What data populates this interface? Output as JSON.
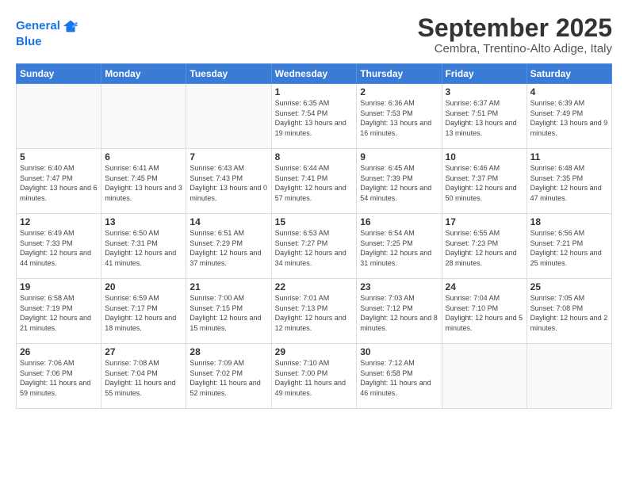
{
  "logo": {
    "line1": "General",
    "line2": "Blue"
  },
  "title": "September 2025",
  "location": "Cembra, Trentino-Alto Adige, Italy",
  "weekdays": [
    "Sunday",
    "Monday",
    "Tuesday",
    "Wednesday",
    "Thursday",
    "Friday",
    "Saturday"
  ],
  "days": [
    null,
    null,
    null,
    {
      "num": "1",
      "sunrise": "Sunrise: 6:35 AM",
      "sunset": "Sunset: 7:54 PM",
      "daylight": "Daylight: 13 hours and 19 minutes."
    },
    {
      "num": "2",
      "sunrise": "Sunrise: 6:36 AM",
      "sunset": "Sunset: 7:53 PM",
      "daylight": "Daylight: 13 hours and 16 minutes."
    },
    {
      "num": "3",
      "sunrise": "Sunrise: 6:37 AM",
      "sunset": "Sunset: 7:51 PM",
      "daylight": "Daylight: 13 hours and 13 minutes."
    },
    {
      "num": "4",
      "sunrise": "Sunrise: 6:39 AM",
      "sunset": "Sunset: 7:49 PM",
      "daylight": "Daylight: 13 hours and 9 minutes."
    },
    {
      "num": "5",
      "sunrise": "Sunrise: 6:40 AM",
      "sunset": "Sunset: 7:47 PM",
      "daylight": "Daylight: 13 hours and 6 minutes."
    },
    {
      "num": "6",
      "sunrise": "Sunrise: 6:41 AM",
      "sunset": "Sunset: 7:45 PM",
      "daylight": "Daylight: 13 hours and 3 minutes."
    },
    {
      "num": "7",
      "sunrise": "Sunrise: 6:43 AM",
      "sunset": "Sunset: 7:43 PM",
      "daylight": "Daylight: 13 hours and 0 minutes."
    },
    {
      "num": "8",
      "sunrise": "Sunrise: 6:44 AM",
      "sunset": "Sunset: 7:41 PM",
      "daylight": "Daylight: 12 hours and 57 minutes."
    },
    {
      "num": "9",
      "sunrise": "Sunrise: 6:45 AM",
      "sunset": "Sunset: 7:39 PM",
      "daylight": "Daylight: 12 hours and 54 minutes."
    },
    {
      "num": "10",
      "sunrise": "Sunrise: 6:46 AM",
      "sunset": "Sunset: 7:37 PM",
      "daylight": "Daylight: 12 hours and 50 minutes."
    },
    {
      "num": "11",
      "sunrise": "Sunrise: 6:48 AM",
      "sunset": "Sunset: 7:35 PM",
      "daylight": "Daylight: 12 hours and 47 minutes."
    },
    {
      "num": "12",
      "sunrise": "Sunrise: 6:49 AM",
      "sunset": "Sunset: 7:33 PM",
      "daylight": "Daylight: 12 hours and 44 minutes."
    },
    {
      "num": "13",
      "sunrise": "Sunrise: 6:50 AM",
      "sunset": "Sunset: 7:31 PM",
      "daylight": "Daylight: 12 hours and 41 minutes."
    },
    {
      "num": "14",
      "sunrise": "Sunrise: 6:51 AM",
      "sunset": "Sunset: 7:29 PM",
      "daylight": "Daylight: 12 hours and 37 minutes."
    },
    {
      "num": "15",
      "sunrise": "Sunrise: 6:53 AM",
      "sunset": "Sunset: 7:27 PM",
      "daylight": "Daylight: 12 hours and 34 minutes."
    },
    {
      "num": "16",
      "sunrise": "Sunrise: 6:54 AM",
      "sunset": "Sunset: 7:25 PM",
      "daylight": "Daylight: 12 hours and 31 minutes."
    },
    {
      "num": "17",
      "sunrise": "Sunrise: 6:55 AM",
      "sunset": "Sunset: 7:23 PM",
      "daylight": "Daylight: 12 hours and 28 minutes."
    },
    {
      "num": "18",
      "sunrise": "Sunrise: 6:56 AM",
      "sunset": "Sunset: 7:21 PM",
      "daylight": "Daylight: 12 hours and 25 minutes."
    },
    {
      "num": "19",
      "sunrise": "Sunrise: 6:58 AM",
      "sunset": "Sunset: 7:19 PM",
      "daylight": "Daylight: 12 hours and 21 minutes."
    },
    {
      "num": "20",
      "sunrise": "Sunrise: 6:59 AM",
      "sunset": "Sunset: 7:17 PM",
      "daylight": "Daylight: 12 hours and 18 minutes."
    },
    {
      "num": "21",
      "sunrise": "Sunrise: 7:00 AM",
      "sunset": "Sunset: 7:15 PM",
      "daylight": "Daylight: 12 hours and 15 minutes."
    },
    {
      "num": "22",
      "sunrise": "Sunrise: 7:01 AM",
      "sunset": "Sunset: 7:13 PM",
      "daylight": "Daylight: 12 hours and 12 minutes."
    },
    {
      "num": "23",
      "sunrise": "Sunrise: 7:03 AM",
      "sunset": "Sunset: 7:12 PM",
      "daylight": "Daylight: 12 hours and 8 minutes."
    },
    {
      "num": "24",
      "sunrise": "Sunrise: 7:04 AM",
      "sunset": "Sunset: 7:10 PM",
      "daylight": "Daylight: 12 hours and 5 minutes."
    },
    {
      "num": "25",
      "sunrise": "Sunrise: 7:05 AM",
      "sunset": "Sunset: 7:08 PM",
      "daylight": "Daylight: 12 hours and 2 minutes."
    },
    {
      "num": "26",
      "sunrise": "Sunrise: 7:06 AM",
      "sunset": "Sunset: 7:06 PM",
      "daylight": "Daylight: 11 hours and 59 minutes."
    },
    {
      "num": "27",
      "sunrise": "Sunrise: 7:08 AM",
      "sunset": "Sunset: 7:04 PM",
      "daylight": "Daylight: 11 hours and 55 minutes."
    },
    {
      "num": "28",
      "sunrise": "Sunrise: 7:09 AM",
      "sunset": "Sunset: 7:02 PM",
      "daylight": "Daylight: 11 hours and 52 minutes."
    },
    {
      "num": "29",
      "sunrise": "Sunrise: 7:10 AM",
      "sunset": "Sunset: 7:00 PM",
      "daylight": "Daylight: 11 hours and 49 minutes."
    },
    {
      "num": "30",
      "sunrise": "Sunrise: 7:12 AM",
      "sunset": "Sunset: 6:58 PM",
      "daylight": "Daylight: 11 hours and 46 minutes."
    },
    null,
    null,
    null,
    null
  ]
}
